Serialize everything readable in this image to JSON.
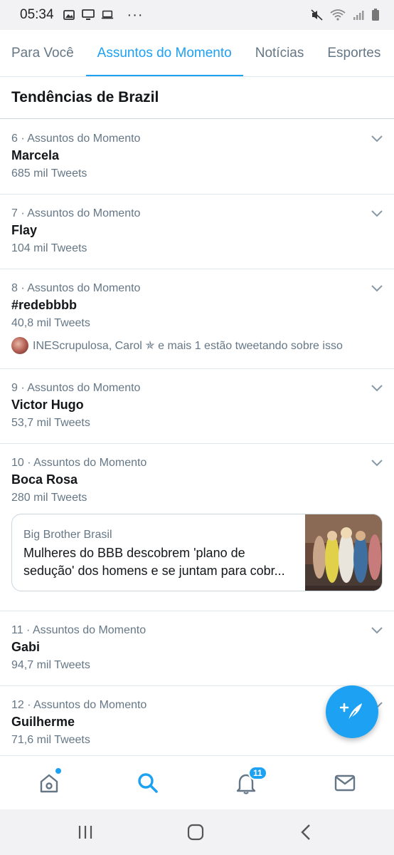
{
  "status_bar": {
    "time": "05:34",
    "left_icons": [
      "gallery-icon",
      "monitor-icon",
      "laptop-icon"
    ],
    "more": "···",
    "right_icons": [
      "mute-icon",
      "wifi-icon",
      "signal-icon",
      "battery-icon"
    ]
  },
  "tabs": [
    {
      "label": "Para Você",
      "active": false
    },
    {
      "label": "Assuntos do Momento",
      "active": true
    },
    {
      "label": "Notícias",
      "active": false
    },
    {
      "label": "Esportes",
      "active": false
    }
  ],
  "section_title": "Tendências de Brazil",
  "trends": [
    {
      "meta": "6 · Assuntos do Momento",
      "name": "Marcela",
      "count": "685 mil Tweets"
    },
    {
      "meta": "7 · Assuntos do Momento",
      "name": "Flay",
      "count": "104 mil Tweets"
    },
    {
      "meta": "8 · Assuntos do Momento",
      "name": "#redebbbb",
      "count": "40,8 mil Tweets",
      "tweeting": "INEScrupulosa, Carol ✯ e mais 1 estão tweetando sobre isso"
    },
    {
      "meta": "9 · Assuntos do Momento",
      "name": "Victor Hugo",
      "count": "53,7 mil Tweets"
    },
    {
      "meta": "10 · Assuntos do Momento",
      "name": "Boca Rosa",
      "count": "280 mil Tweets"
    },
    {
      "meta": "11 · Assuntos do Momento",
      "name": "Gabi",
      "count": "94,7 mil Tweets"
    },
    {
      "meta": "12 · Assuntos do Momento",
      "name": "Guilherme",
      "count": "71,6 mil Tweets"
    }
  ],
  "news_card": {
    "source": "Big Brother Brasil",
    "headline_line1": "Mulheres do BBB descobrem 'plano de",
    "headline_line2": "sedução' dos homens e se juntam para cobr..."
  },
  "bottom_nav": {
    "items": [
      "home-icon",
      "search-icon",
      "notifications-icon",
      "messages-icon"
    ],
    "notifications_badge": "11",
    "active": "search-icon"
  },
  "colors": {
    "accent": "#1da1f2",
    "text_primary": "#14171a",
    "text_secondary": "#657786"
  }
}
